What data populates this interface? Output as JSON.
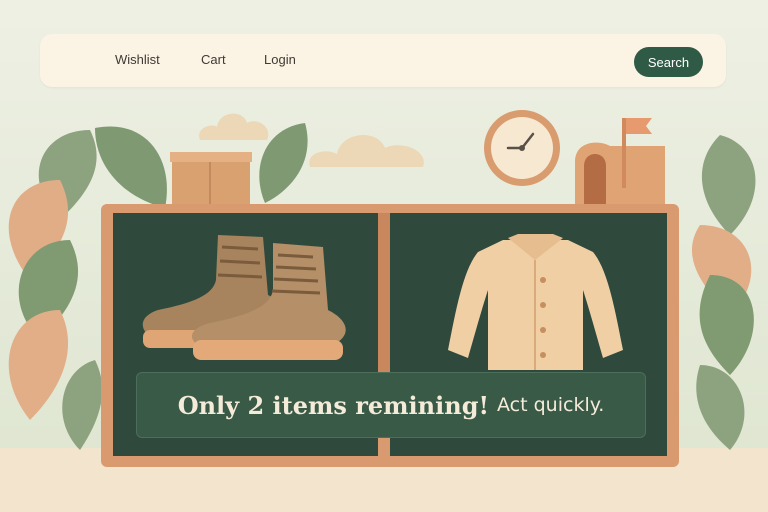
{
  "nav": {
    "links": [
      "Wishlist",
      "Cart",
      "Login"
    ],
    "search_label": "Search"
  },
  "promo": {
    "headline": "Only 2 items remining!",
    "subtext": "Act quickly."
  },
  "products": [
    {
      "name": "boots",
      "icon": "boots-icon"
    },
    {
      "name": "shirt",
      "icon": "shirt-icon"
    }
  ],
  "colors": {
    "accent": "#2f5a45",
    "board": "#2f4a3d",
    "frame": "#d89a6e",
    "navbar": "#fbf3e3"
  }
}
